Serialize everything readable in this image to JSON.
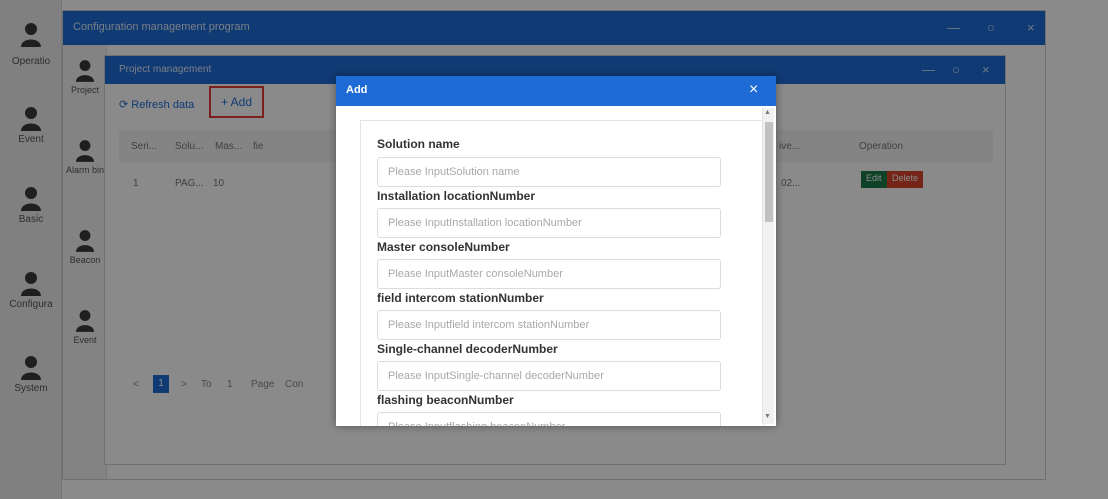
{
  "sidebar": {
    "items": [
      {
        "label": ""
      },
      {
        "label": "Operatio"
      },
      {
        "label": "Event"
      },
      {
        "label": "Basic"
      },
      {
        "label": "Configura"
      },
      {
        "label": "System"
      }
    ]
  },
  "config_window": {
    "title": "Configuration management program",
    "controls": {
      "minimize": "—",
      "maximize": "○",
      "close": "×"
    },
    "subnav": [
      {
        "label": "Project"
      },
      {
        "label": "Alarm bin"
      },
      {
        "label": "Beacon"
      },
      {
        "label": "Event"
      }
    ]
  },
  "project_window": {
    "title": "Project management",
    "controls": {
      "minimize": "—",
      "maximize": "○",
      "close": "×"
    },
    "toolbar": {
      "refresh_label": "Refresh data",
      "refresh_icon": "refresh-icon",
      "add_label": "+ Add"
    },
    "table": {
      "columns": [
        "Seri...",
        "Solu...",
        "Mas...",
        "fie",
        "ive...",
        "Operation"
      ],
      "rows": [
        {
          "serial": "1",
          "solution": "PAG...",
          "master": "10",
          "ive": "02...",
          "edit": "Edit",
          "delete": "Delete"
        }
      ]
    },
    "pager": {
      "prev": "<",
      "current": "1",
      "next": ">",
      "to_label": "To",
      "page_input": "1",
      "page_label": "Page",
      "confirm_label": "Con"
    }
  },
  "dialog": {
    "title": "Add",
    "close_label": "×",
    "fields": [
      {
        "label": "Solution name",
        "placeholder": "Please InputSolution name"
      },
      {
        "label": "Installation locationNumber",
        "placeholder": "Please InputInstallation locationNumber"
      },
      {
        "label": "Master consoleNumber",
        "placeholder": "Please InputMaster consoleNumber"
      },
      {
        "label": "field intercom stationNumber",
        "placeholder": "Please Inputfield intercom stationNumber"
      },
      {
        "label": "Single-channel decoderNumber",
        "placeholder": "Please InputSingle-channel decoderNumber"
      },
      {
        "label": "flashing beaconNumber",
        "placeholder": "Please Inputflashing beaconNumber"
      }
    ],
    "scroll_up": "▲",
    "scroll_down": "▼"
  },
  "colors": {
    "title_bar": "#1e6bd6",
    "highlight_box": "#e53935",
    "edit_button": "#1f7a4a",
    "delete_button": "#d9432e"
  }
}
